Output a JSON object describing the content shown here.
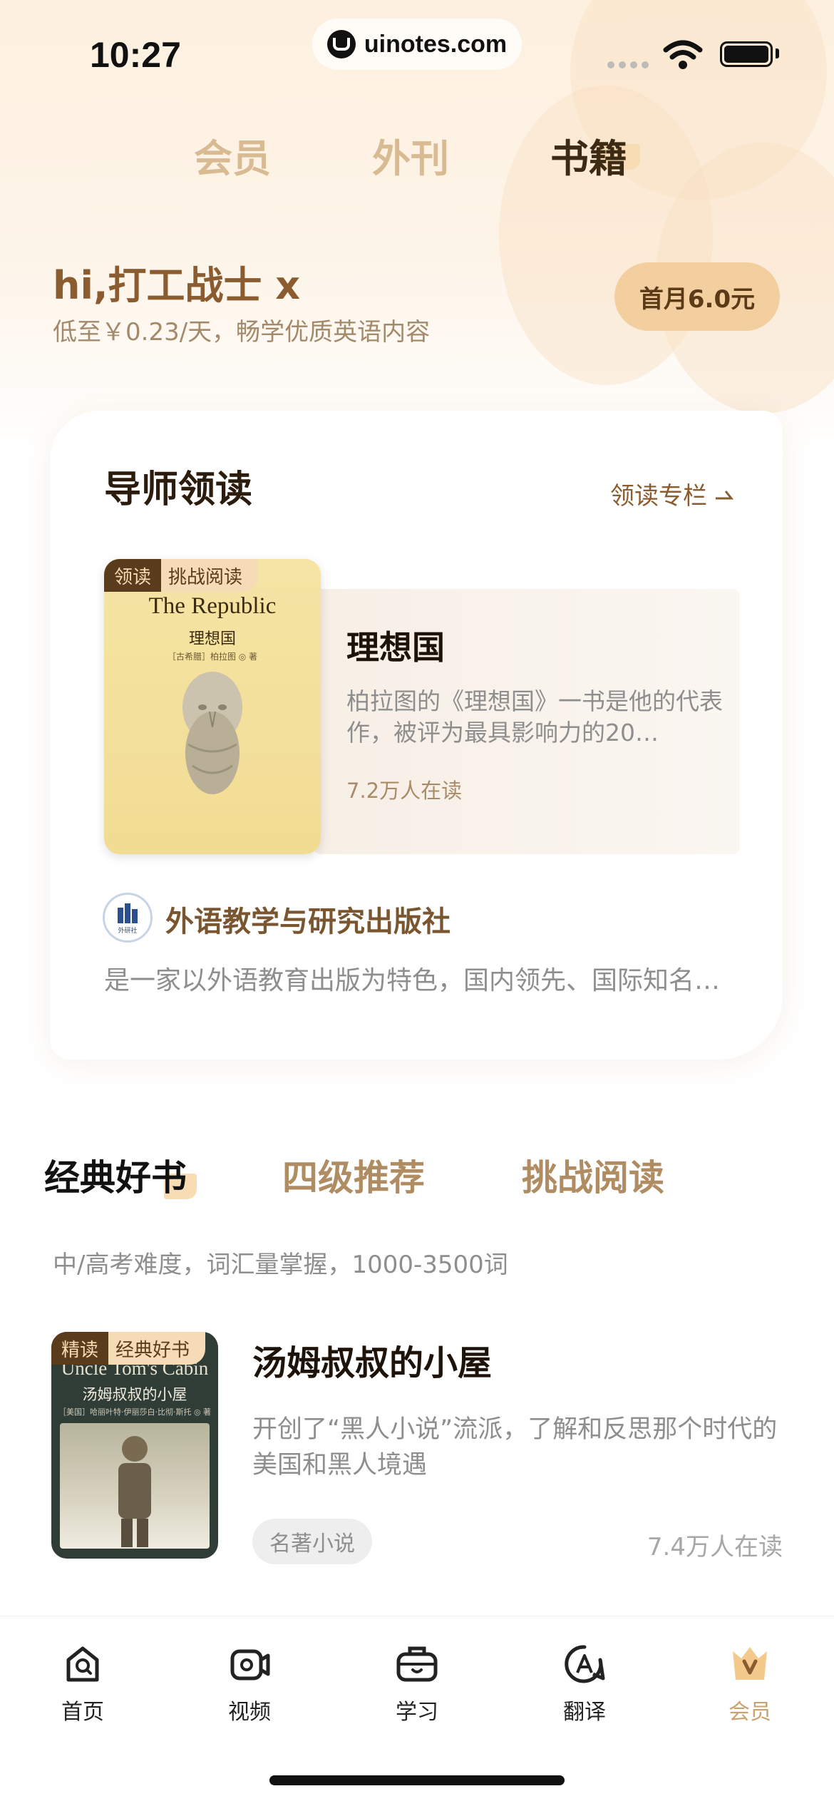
{
  "status_bar": {
    "time": "10:27",
    "url": "uinotes.com"
  },
  "top_tabs": [
    {
      "label": "会员",
      "active": false
    },
    {
      "label": "外刊",
      "active": false
    },
    {
      "label": "书籍",
      "active": true
    }
  ],
  "header": {
    "greeting": "hi,打工战士 x",
    "subtitle": "低至￥0.23/天，畅学优质英语内容",
    "price_button": "首月6.0元"
  },
  "featured": {
    "title": "导师领读",
    "link": "领读专栏",
    "book": {
      "tag_primary": "领读",
      "tag_secondary": "挑战阅读",
      "cover_en": "The Republic",
      "cover_cn": "理想国",
      "cover_author": "［古希腊］柏拉图 ◎ 著",
      "title": "理想国",
      "description": "柏拉图的《理想国》一书是他的代表作，被评为最具影响力的20…",
      "readers": "7.2万人在读"
    },
    "publisher": {
      "logo_text": "外研社",
      "name": "外语教学与研究出版社",
      "description": "是一家以外语教育出版为特色，国内领先、国际知名…"
    }
  },
  "category_tabs": [
    {
      "label": "经典好书",
      "active": true
    },
    {
      "label": "四级推荐",
      "active": false
    },
    {
      "label": "挑战阅读",
      "active": false
    }
  ],
  "category_description": "中/高考难度，词汇量掌握，1000-3500词",
  "book_list": [
    {
      "tag_primary": "精读",
      "tag_secondary": "经典好书",
      "cover_en": "Uncle Tom's Cabin",
      "cover_cn": "汤姆叔叔的小屋",
      "cover_author": "［美国］哈丽叶特·伊丽莎白·比彻·斯托 ◎ 著",
      "title": "汤姆叔叔的小屋",
      "description": "开创了“黑人小说”流派，了解和反思那个时代的美国和黑人境遇",
      "genre": "名著小说",
      "readers": "7.4万人在读"
    }
  ],
  "bottom_nav": [
    {
      "label": "首页",
      "icon": "home-icon",
      "active": false
    },
    {
      "label": "视频",
      "icon": "video-icon",
      "active": false
    },
    {
      "label": "学习",
      "icon": "study-bag-icon",
      "active": false
    },
    {
      "label": "翻译",
      "icon": "translate-icon",
      "active": false
    },
    {
      "label": "会员",
      "icon": "vip-crown-icon",
      "active": true
    }
  ],
  "colors": {
    "accent_brown": "#8a5c2f",
    "accent_light": "#f3cfa0",
    "nav_active": "#c9a36e",
    "tab_inactive": "#d9bb93"
  }
}
